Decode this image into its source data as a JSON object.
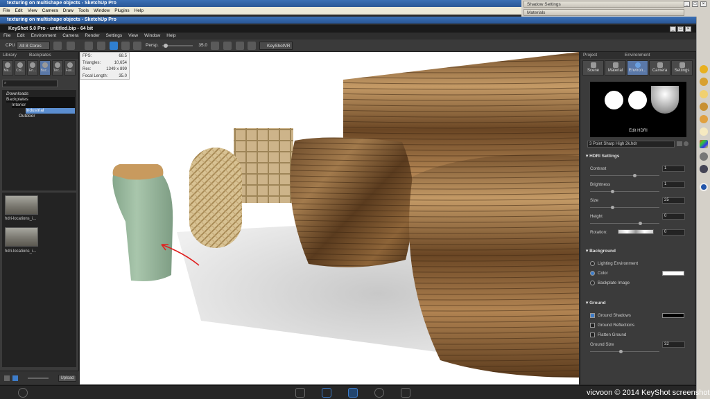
{
  "sketchup": {
    "title": "texturing on multishape objects - SketchUp Pro",
    "title_repeat": "texturing on multishape objects - SketchUp Pro",
    "menu": [
      "File",
      "Edit",
      "View",
      "Camera",
      "Draw",
      "Tools",
      "Window",
      "Plugins",
      "Help"
    ],
    "panels": [
      "Shadow Settings",
      "Materials"
    ]
  },
  "keyshot": {
    "title": "KeyShot 5.0 Pro - untitled.bip - 64 bit",
    "menu": [
      "File",
      "Edit",
      "Environment",
      "Camera",
      "Render",
      "Settings",
      "View",
      "Window",
      "Help"
    ],
    "toolbar": {
      "cpu_label": "CPU",
      "cores_value": "All 8 Cores",
      "persp_label": "Persp.",
      "fov_value": "35.0",
      "keyshotvr_label": "KeyShotVR"
    }
  },
  "library": {
    "header_left": "Library",
    "header_title": "Backplates",
    "tabs": [
      "Ma...",
      "Col...",
      "En...",
      "Bac...",
      "Tex...",
      "Fav..."
    ],
    "tree": [
      {
        "label": "Downloads",
        "indent": 0,
        "italic": true
      },
      {
        "label": "Backplates",
        "indent": 0,
        "italic": false
      },
      {
        "label": "Interior",
        "indent": 1,
        "italic": false
      },
      {
        "label": "Industrial",
        "indent": 2,
        "italic": false,
        "selected": true
      },
      {
        "label": "Outdoor",
        "indent": 1,
        "italic": false
      }
    ],
    "thumbnails": [
      "hdri-locations_i...",
      "hdri-locations_i..."
    ],
    "upload_label": "Upload"
  },
  "stats": {
    "fps_label": "FPS:",
    "fps_value": "68.5",
    "tri_label": "Triangles:",
    "tri_value": "10,654",
    "res_label": "Res:",
    "res_value": "1349 x 899",
    "focal_label": "Focal Length:",
    "focal_value": "35.0"
  },
  "project": {
    "header_left": "Project",
    "header_title": "Environment",
    "tabs": [
      "Scene",
      "Material",
      "Environ...",
      "Camera",
      "Settings"
    ],
    "edit_hdri_label": "Edit HDRI",
    "hdri_file": "3 Point Sharp High 2k.hdr",
    "hdri_settings_title": "HDRI Settings",
    "settings": [
      {
        "label": "Contrast",
        "value": "1"
      },
      {
        "label": "Brightness",
        "value": "1"
      },
      {
        "label": "Size",
        "value": "25"
      },
      {
        "label": "Height",
        "value": "0"
      }
    ],
    "rotation_label": "Rotation:",
    "rotation_value": "0",
    "background_title": "Background",
    "background_options": [
      "Lighting Environment",
      "Color",
      "Backplate Image"
    ],
    "background_selected": "Color",
    "background_color": "#ffffff",
    "ground_title": "Ground",
    "ground_options": [
      {
        "label": "Ground Shadows",
        "checked": true
      },
      {
        "label": "Ground Reflections",
        "checked": false
      },
      {
        "label": "Flatten Ground",
        "checked": false
      }
    ],
    "shadow_color": "#000000",
    "ground_size_label": "Ground Size",
    "ground_size_value": "32"
  },
  "watermark": "vicvoon © 2014 KeyShot screenshot",
  "colors": {
    "accent": "#3d7cc9",
    "panel_bg": "#3b3b3b",
    "viewport_bg": "#ffffff",
    "annotation_arrow": "#e02020",
    "vase_color": "#9fbfa3"
  }
}
